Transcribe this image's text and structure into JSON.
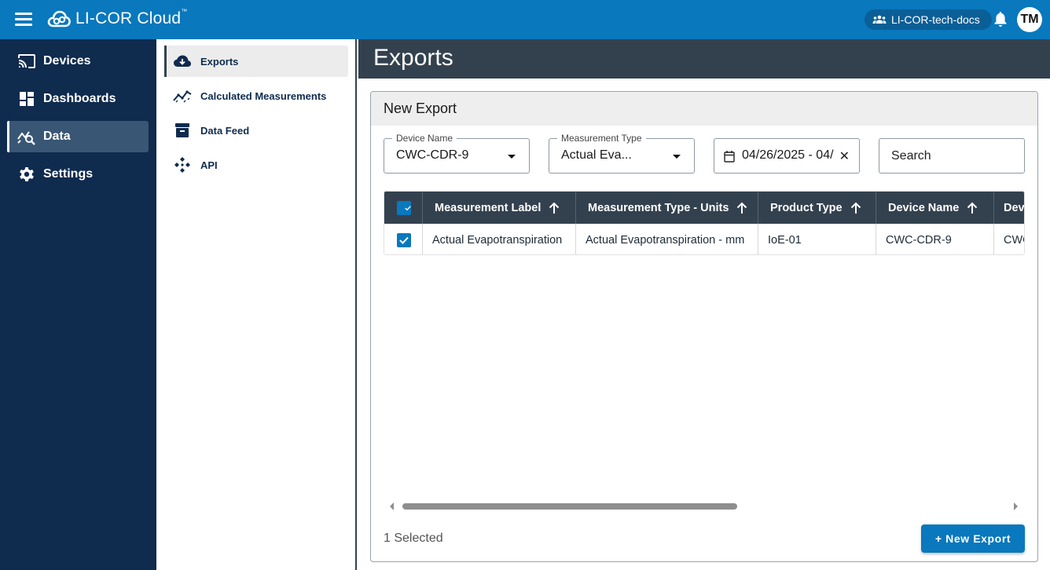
{
  "app": {
    "brand_name": "LI-COR Cloud",
    "trademark": "™",
    "organization": "LI-COR-tech-docs",
    "user_initials": "TM"
  },
  "colors": {
    "topbar": "#0978bd",
    "sidebar": "#0f2b4e",
    "header_dark": "#33414f",
    "accent": "#0978bd"
  },
  "sidebar": {
    "items": [
      {
        "label": "Devices",
        "icon": "cast-icon",
        "active": false
      },
      {
        "label": "Dashboards",
        "icon": "dashboard-icon",
        "active": false
      },
      {
        "label": "Data",
        "icon": "data-analytics-icon",
        "active": true
      },
      {
        "label": "Settings",
        "icon": "gear-icon",
        "active": false
      }
    ]
  },
  "subnav": {
    "items": [
      {
        "label": "Exports",
        "icon": "cloud-download-icon",
        "active": true
      },
      {
        "label": "Calculated Measurements",
        "icon": "line-chart-icon",
        "active": false
      },
      {
        "label": "Data Feed",
        "icon": "archive-box-icon",
        "active": false
      },
      {
        "label": "API",
        "icon": "api-icon",
        "active": false
      }
    ]
  },
  "page": {
    "title": "Exports"
  },
  "card": {
    "title": "New Export",
    "filters": {
      "device_name": {
        "label": "Device Name",
        "value": "CWC-CDR-9"
      },
      "measurement_type": {
        "label": "Measurement Type",
        "value": "Actual Eva..."
      },
      "date_range": {
        "value": "04/26/2025 - 04/"
      },
      "search": {
        "placeholder": "Search",
        "value": ""
      }
    },
    "table": {
      "columns": [
        "Measurement Label",
        "Measurement Type - Units",
        "Product Type",
        "Device Name",
        "Device"
      ],
      "column_visible_text": [
        "Measurement Label",
        "Measurement Type - Units",
        "Product Type",
        "Device Name",
        "Devi"
      ],
      "rows": [
        {
          "checked": true,
          "cells": [
            "Actual Evapotranspiration",
            "Actual Evapotranspiration - mm",
            "IoE-01",
            "CWC-CDR-9",
            "CWC"
          ]
        }
      ],
      "header_checked": true
    },
    "selected_count_text": "1 Selected",
    "new_export_button": "+ New Export"
  }
}
